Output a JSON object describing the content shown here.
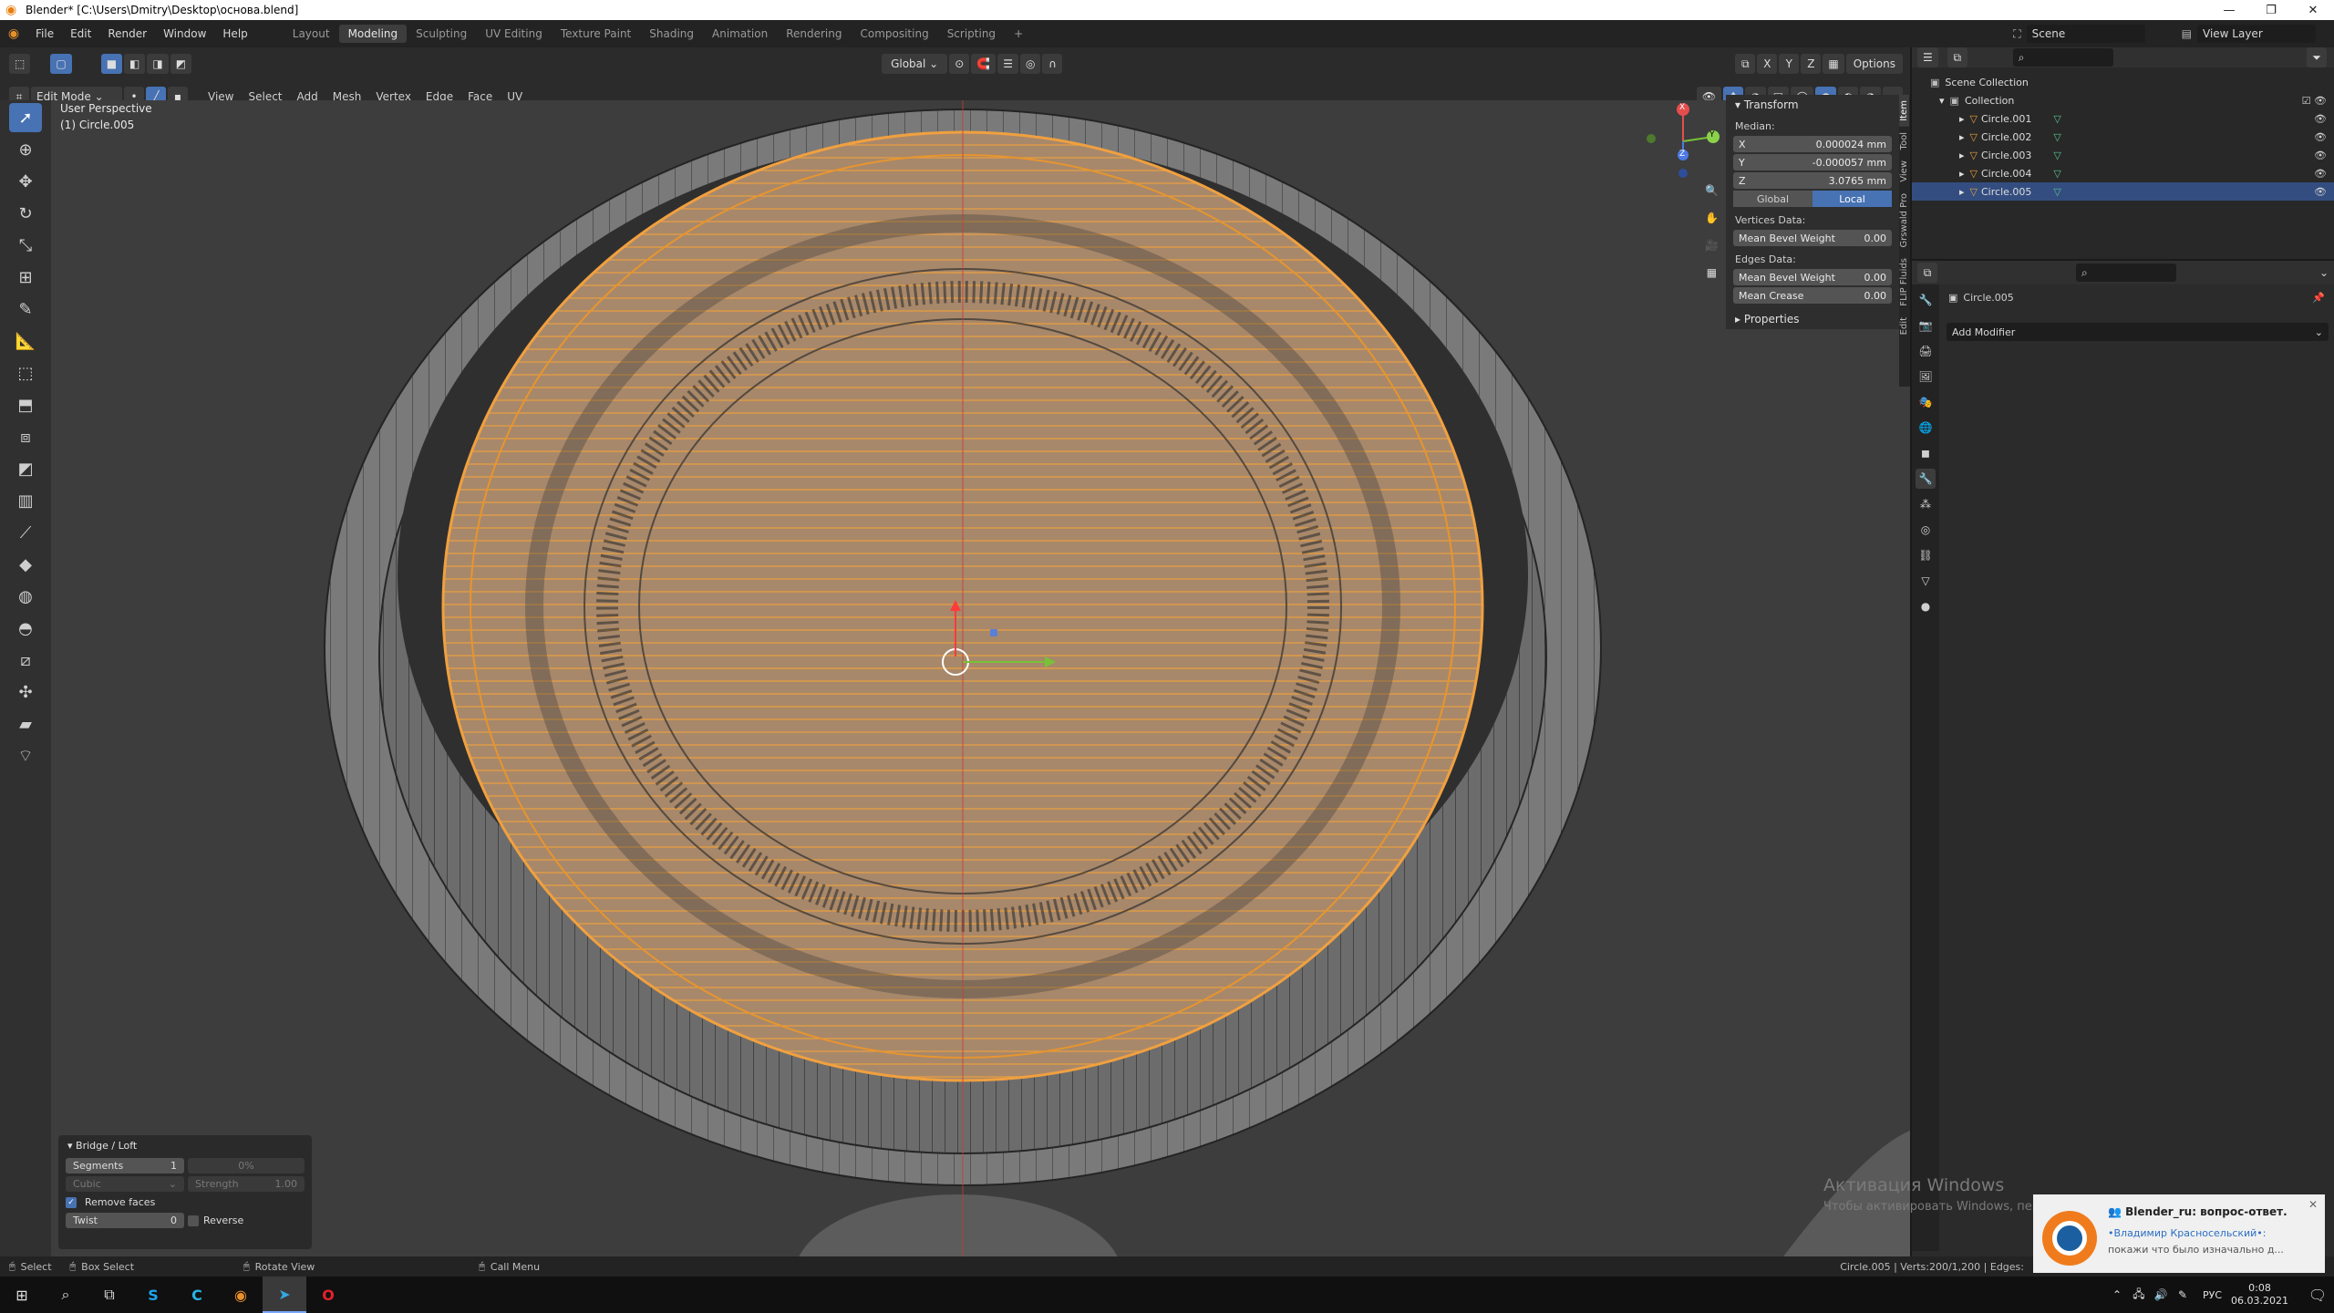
{
  "window": {
    "title": "Blender* [C:\\Users\\Dmitry\\Desktop\\основа.blend]",
    "minimize": "—",
    "restore": "❐",
    "close": "✕"
  },
  "menu": [
    "File",
    "Edit",
    "Render",
    "Window",
    "Help"
  ],
  "workspaces": [
    {
      "label": "Layout",
      "active": false
    },
    {
      "label": "Modeling",
      "active": true
    },
    {
      "label": "Sculpting",
      "active": false
    },
    {
      "label": "UV Editing",
      "active": false
    },
    {
      "label": "Texture Paint",
      "active": false
    },
    {
      "label": "Shading",
      "active": false
    },
    {
      "label": "Animation",
      "active": false
    },
    {
      "label": "Rendering",
      "active": false
    },
    {
      "label": "Compositing",
      "active": false
    },
    {
      "label": "Scripting",
      "active": false
    }
  ],
  "add_workspace": "+",
  "scene": {
    "name": "Scene",
    "view_layer": "View Layer"
  },
  "header": {
    "transform_orientation": "Global",
    "options": "Options",
    "axes": [
      "X",
      "Y",
      "Z"
    ],
    "mode": "Edit Mode",
    "menus": [
      "View",
      "Select",
      "Add",
      "Mesh",
      "Vertex",
      "Edge",
      "Face",
      "UV"
    ]
  },
  "viewport": {
    "perspective_label": "User Perspective",
    "object_label": "(1) Circle.005",
    "gizmo_axes": {
      "x": "X",
      "y": "Y",
      "z": "Z"
    },
    "mesh_color": "#e8902a"
  },
  "n_panel": {
    "transform_title": "Transform",
    "median_label": "Median:",
    "fields": [
      {
        "axis": "X",
        "value": "0.000024 mm"
      },
      {
        "axis": "Y",
        "value": "-0.000057 mm"
      },
      {
        "axis": "Z",
        "value": "3.0765 mm"
      }
    ],
    "global": "Global",
    "local": "Local",
    "vertices_label": "Vertices Data:",
    "vertex_bevel": {
      "label": "Mean Bevel Weight",
      "value": "0.00"
    },
    "edges_label": "Edges Data:",
    "edge_bevel": {
      "label": "Mean Bevel Weight",
      "value": "0.00"
    },
    "edge_crease": {
      "label": "Mean Crease",
      "value": "0.00"
    },
    "properties_title": "Properties",
    "tabs": [
      "Item",
      "Tool",
      "View",
      "Grswald Pro",
      "FLIP Fluids",
      "Edit"
    ]
  },
  "redo_panel": {
    "title": "Bridge / Loft",
    "segments": {
      "label": "Segments",
      "value": "1"
    },
    "percent": "0%",
    "interp": "Cubic",
    "strength": {
      "label": "Strength",
      "value": "1.00"
    },
    "remove_faces": "Remove faces",
    "twist": {
      "label": "Twist",
      "value": "0"
    },
    "reverse": "Reverse"
  },
  "outliner": {
    "root": "Scene Collection",
    "collection": "Collection",
    "items": [
      {
        "name": "Circle.001",
        "selected": false
      },
      {
        "name": "Circle.002",
        "selected": false
      },
      {
        "name": "Circle.003",
        "selected": false
      },
      {
        "name": "Circle.004",
        "selected": false
      },
      {
        "name": "Circle.005",
        "selected": true
      }
    ]
  },
  "properties": {
    "object_name": "Circle.005",
    "add_modifier": "Add Modifier"
  },
  "status": {
    "select": "Select",
    "box_select": "Box Select",
    "rotate_view": "Rotate View",
    "call_menu": "Call Menu",
    "stats": "Circle.005 | Verts:200/1,200 | Edges:"
  },
  "watermark": {
    "line1": "Активация Windows",
    "line2": "Чтобы активировать Windows, перейдите в раздел \"Параметры\"."
  },
  "toast": {
    "title": "Blender_ru: вопрос-ответ.",
    "sender": "•Владимир Красносельский•:",
    "message": "покажи что было изначально д..."
  },
  "taskbar": {
    "lang": "РУС",
    "time": "0:08",
    "date": "06.03.2021"
  }
}
